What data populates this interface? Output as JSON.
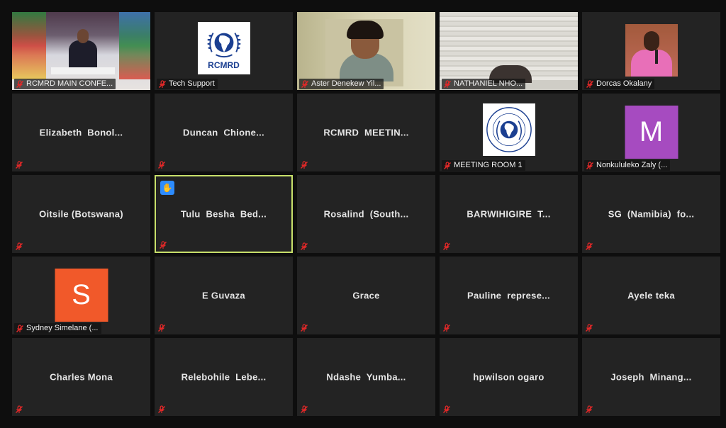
{
  "participants": [
    {
      "name": "RCMRD MAIN CONFE...",
      "kind": "video-conference-room"
    },
    {
      "name": "Tech Support",
      "kind": "logo",
      "logo_text": "RCMRD"
    },
    {
      "name": "Aster Denekew Yil...",
      "kind": "video-person"
    },
    {
      "name": "NATHANIEL NHO...",
      "kind": "video-blinds"
    },
    {
      "name": "Dorcas Okalany",
      "kind": "video-speaker"
    },
    {
      "name": "Elizabeth  Bonol...",
      "kind": "name-only"
    },
    {
      "name": "Duncan  Chione...",
      "kind": "name-only"
    },
    {
      "name": "RCMRD  MEETIN...",
      "kind": "name-only"
    },
    {
      "name": "MEETING ROOM 1",
      "kind": "logo",
      "logo_text": ""
    },
    {
      "name": "Nonkululeko Zaly (...",
      "kind": "avatar",
      "initial": "M",
      "color": "#a64bc0"
    },
    {
      "name": "Oitsile (Botswana)",
      "kind": "name-only"
    },
    {
      "name": "Tulu  Besha  Bed...",
      "kind": "name-only",
      "active_speaker": true,
      "hand_raised": true
    },
    {
      "name": "Rosalind  (South...",
      "kind": "name-only"
    },
    {
      "name": "BARWIHIGIRE  T...",
      "kind": "name-only"
    },
    {
      "name": "SG  (Namibia)  fo...",
      "kind": "name-only"
    },
    {
      "name": "Sydney Simelane (...",
      "kind": "avatar",
      "initial": "S",
      "color": "#f1592a"
    },
    {
      "name": "E Guvaza",
      "kind": "name-only"
    },
    {
      "name": "Grace",
      "kind": "name-only"
    },
    {
      "name": "Pauline  represe...",
      "kind": "name-only"
    },
    {
      "name": "Ayele teka",
      "kind": "name-only"
    },
    {
      "name": "Charles Mona",
      "kind": "name-only"
    },
    {
      "name": "Relebohile  Lebe...",
      "kind": "name-only"
    },
    {
      "name": "Ndashe  Yumba...",
      "kind": "name-only"
    },
    {
      "name": "hpwilson ogaro",
      "kind": "name-only"
    },
    {
      "name": "Joseph  Minang...",
      "kind": "name-only"
    }
  ],
  "icons": {
    "muted": "mic-muted-icon",
    "raised_hand": "raised-hand-icon"
  },
  "colors": {
    "active_speaker_border": "#c8e06a",
    "muted_icon": "#e02828",
    "tile_bg": "#232323",
    "page_bg": "#0e0e0e"
  }
}
